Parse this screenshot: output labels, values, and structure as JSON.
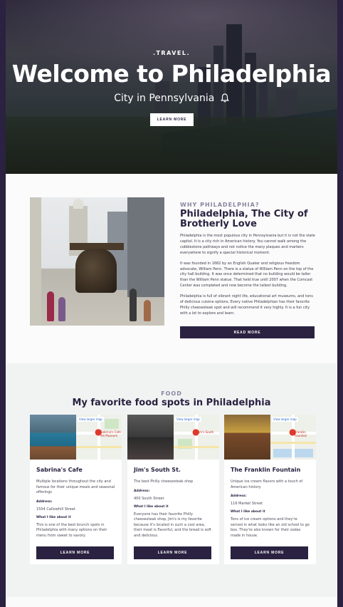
{
  "hero": {
    "tag": ".TRAVEL.",
    "title": "Welcome to Philadelphia",
    "subtitle": "City in Pennsylvania",
    "button_label": "LEARN MORE"
  },
  "about": {
    "eyebrow": "WHY PHILADELPHIA?",
    "title": "Philadelphia, The City of Brotherly Love",
    "paragraphs": [
      "Philadelphia is the most populous city in Pennsylvania but it is not the state capitol. It is a city rich in American history. You cannot walk among the cobblestone pathways and not notice the many plaques and markers everywhere to signify a special historical moment.",
      "It was founded in 1682 by an English Quaker and religious freedom advocate, William Penn. There is a statue of William Penn on the top of the city hall building. It was once determined that no building would be taller than the William Penn statue. That held true until 2007 when the Comcast Center was completed and now become the tallest building.",
      "Philadelphia is full of vibrant night life, educational art museums, and tons of delicious cuisine options. Every native Philadelphian has their favorite Philly cheesesteak spot and will recommend it very highly. It is a fun city with a lot to explore and learn."
    ],
    "button_label": "READ MORE"
  },
  "food": {
    "eyebrow": "FOOD",
    "title": "My favorite food spots in Philadelphia",
    "map_link": "View larger map",
    "address_label": "Address:",
    "like_label": "What I like about it",
    "button_label": "LEARN MORE",
    "cards": [
      {
        "name": "Sabrina's Cafe",
        "description": "Multiple locations throughout the city and famous for their unique meals and seasonal offerings",
        "address": "1504 Callowhill Street",
        "like": "This is one of the best brunch spots in Philadelphia with many options on their menu from sweet to savory.",
        "map_place": "Sabrina's Cafe Art Museum"
      },
      {
        "name": "Jim's South St.",
        "description": "The best Philly cheesesteak shop",
        "address": "400 South Street",
        "like": "Everyone has their favorite Philly cheesesteak shop, Jim's is my favorite because it's located in such a cool area, their meat is flavorful, and the bread is soft and delicious.",
        "map_place": "Jim's South"
      },
      {
        "name": "The Franklin Fountain",
        "description": "Unique ice cream flavors with a touch of American history",
        "address": "116 Market Street",
        "like": "Tons of ice cream options and they're served in what looks like an old school to go box. They're also known for their sodas made in house.",
        "map_place": "Franklin Fountain"
      }
    ]
  },
  "colors": {
    "brand": "#2a2240",
    "accent_text": "#8a86a0",
    "pin": "#e0392c"
  },
  "icons": {
    "hero_subtitle_icon": "bell-icon",
    "map_marker": "map-pin-icon"
  }
}
